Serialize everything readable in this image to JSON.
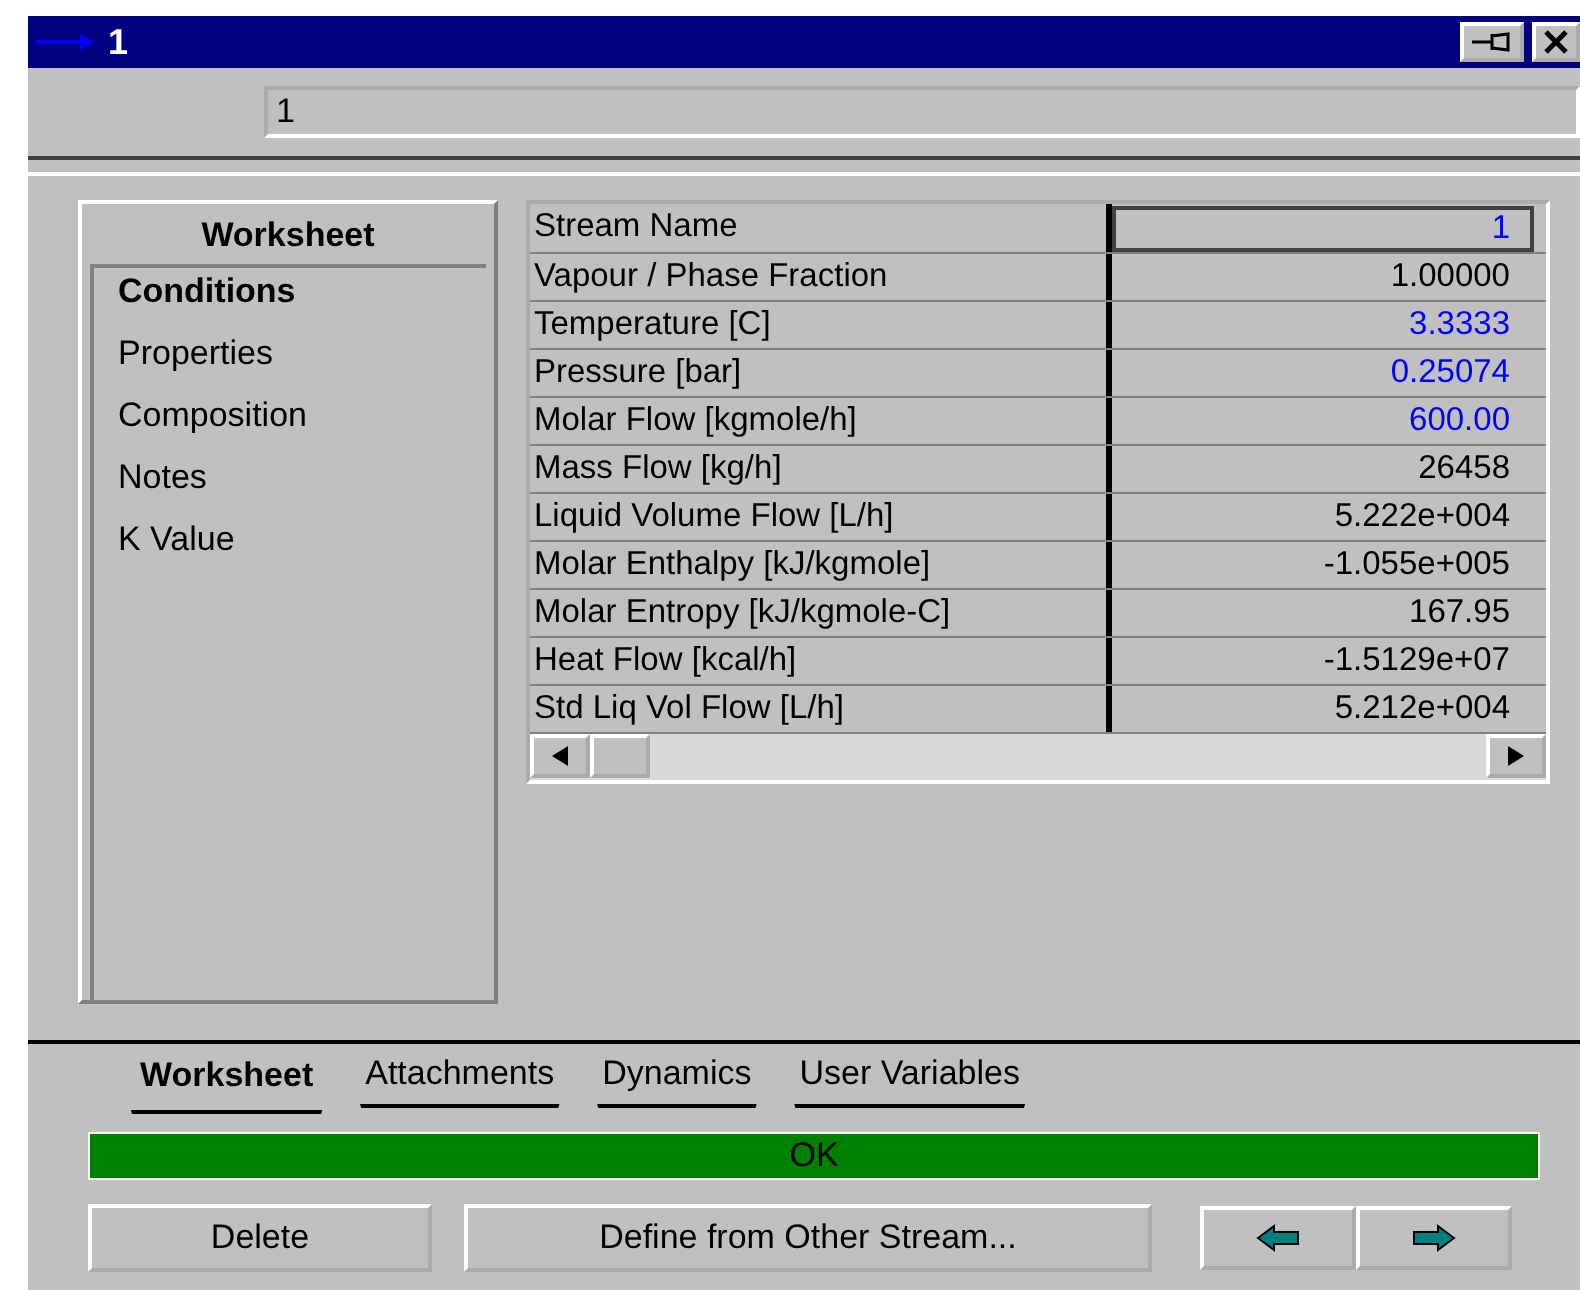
{
  "window": {
    "title": "1"
  },
  "name_field": {
    "value": "1"
  },
  "nav": {
    "heading": "Worksheet",
    "items": [
      {
        "label": "Conditions",
        "selected": true
      },
      {
        "label": "Properties",
        "selected": false
      },
      {
        "label": "Composition",
        "selected": false
      },
      {
        "label": "Notes",
        "selected": false
      },
      {
        "label": "K Value",
        "selected": false
      }
    ]
  },
  "table": {
    "rows": [
      {
        "name": "Stream Name",
        "value": "1",
        "specified": true,
        "selected": true
      },
      {
        "name": "Vapour / Phase Fraction",
        "value": "1.00000",
        "specified": false,
        "selected": false
      },
      {
        "name": "Temperature [C]",
        "value": "3.3333",
        "specified": true,
        "selected": false
      },
      {
        "name": "Pressure [bar]",
        "value": "0.25074",
        "specified": true,
        "selected": false
      },
      {
        "name": "Molar Flow [kgmole/h]",
        "value": "600.00",
        "specified": true,
        "selected": false
      },
      {
        "name": "Mass Flow [kg/h]",
        "value": "26458",
        "specified": false,
        "selected": false
      },
      {
        "name": "Liquid Volume Flow [L/h]",
        "value": "5.222e+004",
        "specified": false,
        "selected": false
      },
      {
        "name": "Molar Enthalpy [kJ/kgmole]",
        "value": "-1.055e+005",
        "specified": false,
        "selected": false
      },
      {
        "name": "Molar Entropy [kJ/kgmole-C]",
        "value": "167.95",
        "specified": false,
        "selected": false
      },
      {
        "name": "Heat Flow [kcal/h]",
        "value": "-1.5129e+07",
        "specified": false,
        "selected": false
      },
      {
        "name": "Std Liq Vol Flow [L/h]",
        "value": "5.212e+004",
        "specified": false,
        "selected": false
      }
    ]
  },
  "tabs": [
    {
      "label": "Worksheet",
      "selected": true
    },
    {
      "label": "Attachments",
      "selected": false
    },
    {
      "label": "Dynamics",
      "selected": false
    },
    {
      "label": "User Variables",
      "selected": false
    }
  ],
  "status": {
    "text": "OK",
    "color": "#008000"
  },
  "buttons": {
    "delete": "Delete",
    "define": "Define from Other Stream..."
  }
}
